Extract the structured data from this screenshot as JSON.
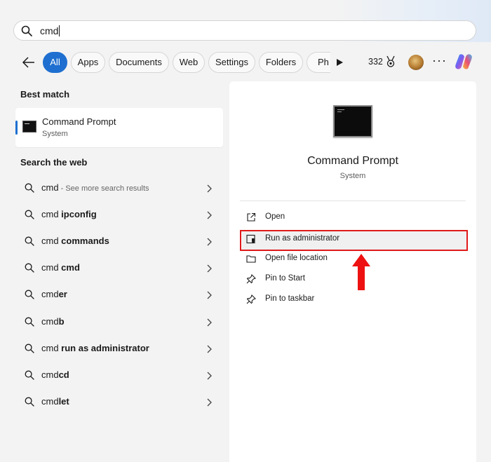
{
  "search": {
    "query": "cmd"
  },
  "filters": {
    "chips": [
      "All",
      "Apps",
      "Documents",
      "Web",
      "Settings",
      "Folders",
      "Ph"
    ],
    "active": "All",
    "points": "332"
  },
  "left": {
    "best_match_title": "Best match",
    "best_match": {
      "name": "Command Prompt",
      "type": "System"
    },
    "web_title": "Search the web",
    "web_items": [
      {
        "prefix": "cmd",
        "bold": "",
        "hint": " - See more search results"
      },
      {
        "prefix": "cmd ",
        "bold": "ipconfig",
        "hint": ""
      },
      {
        "prefix": "cmd ",
        "bold": "commands",
        "hint": ""
      },
      {
        "prefix": "cmd ",
        "bold": "cmd",
        "hint": ""
      },
      {
        "prefix": "cmd",
        "bold": "er",
        "hint": ""
      },
      {
        "prefix": "cmd",
        "bold": "b",
        "hint": ""
      },
      {
        "prefix": "cmd ",
        "bold": "run as administrator",
        "hint": ""
      },
      {
        "prefix": "cmd",
        "bold": "cd",
        "hint": ""
      },
      {
        "prefix": "cmd",
        "bold": "let",
        "hint": ""
      }
    ]
  },
  "right": {
    "app_name": "Command Prompt",
    "app_type": "System",
    "actions": [
      "Open",
      "Run as administrator",
      "Open file location",
      "Pin to Start",
      "Pin to taskbar"
    ],
    "highlighted_action": "Run as administrator"
  },
  "colors": {
    "accent": "#1e6fd0",
    "highlight": "#e01a1a"
  }
}
